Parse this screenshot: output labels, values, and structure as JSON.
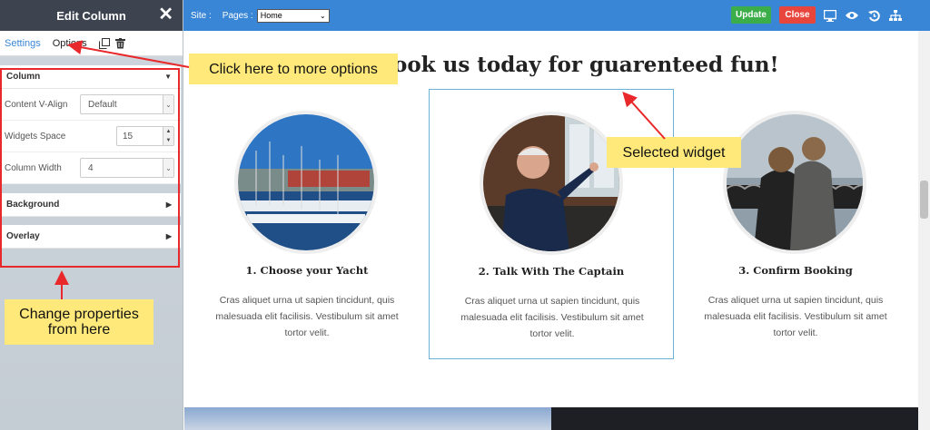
{
  "sidebar": {
    "title": "Edit Column",
    "tabs": {
      "settings": "Settings",
      "options": "Options"
    },
    "column_panel": {
      "label": "Column",
      "props": {
        "valign_label": "Content V-Align",
        "valign_value": "Default",
        "space_label": "Widgets Space",
        "space_value": "15",
        "width_label": "Column Width",
        "width_value": "4"
      }
    },
    "background_panel": "Background",
    "overlay_panel": "Overlay"
  },
  "topbar": {
    "site_label": "Site :",
    "pages_label": "Pages :",
    "pages_value": "Home",
    "update_label": "Update",
    "close_label": "Close"
  },
  "main": {
    "heading": "ook us today for guarenteed fun!",
    "cards": [
      {
        "title": "1. Choose your Yacht",
        "text": "Cras aliquet urna ut sapien tincidunt, quis malesuada elit facilisis. Vestibulum sit amet tortor velit."
      },
      {
        "title": "2. Talk With The Captain",
        "text": "Cras aliquet urna ut sapien tincidunt, quis malesuada elit facilisis. Vestibulum sit amet tortor velit."
      },
      {
        "title": "3. Confirm Booking",
        "text": "Cras aliquet urna ut sapien tincidunt, quis malesuada elit facilisis. Vestibulum sit amet tortor velit."
      }
    ]
  },
  "annotations": {
    "options": "Click here to more options",
    "selected": "Selected widget",
    "change": "Change properties from here"
  },
  "colors": {
    "accent": "#3a86d6",
    "update": "#3cae49",
    "close": "#e8453c",
    "callout": "#ffe97a",
    "annotation": "#e8282a"
  }
}
